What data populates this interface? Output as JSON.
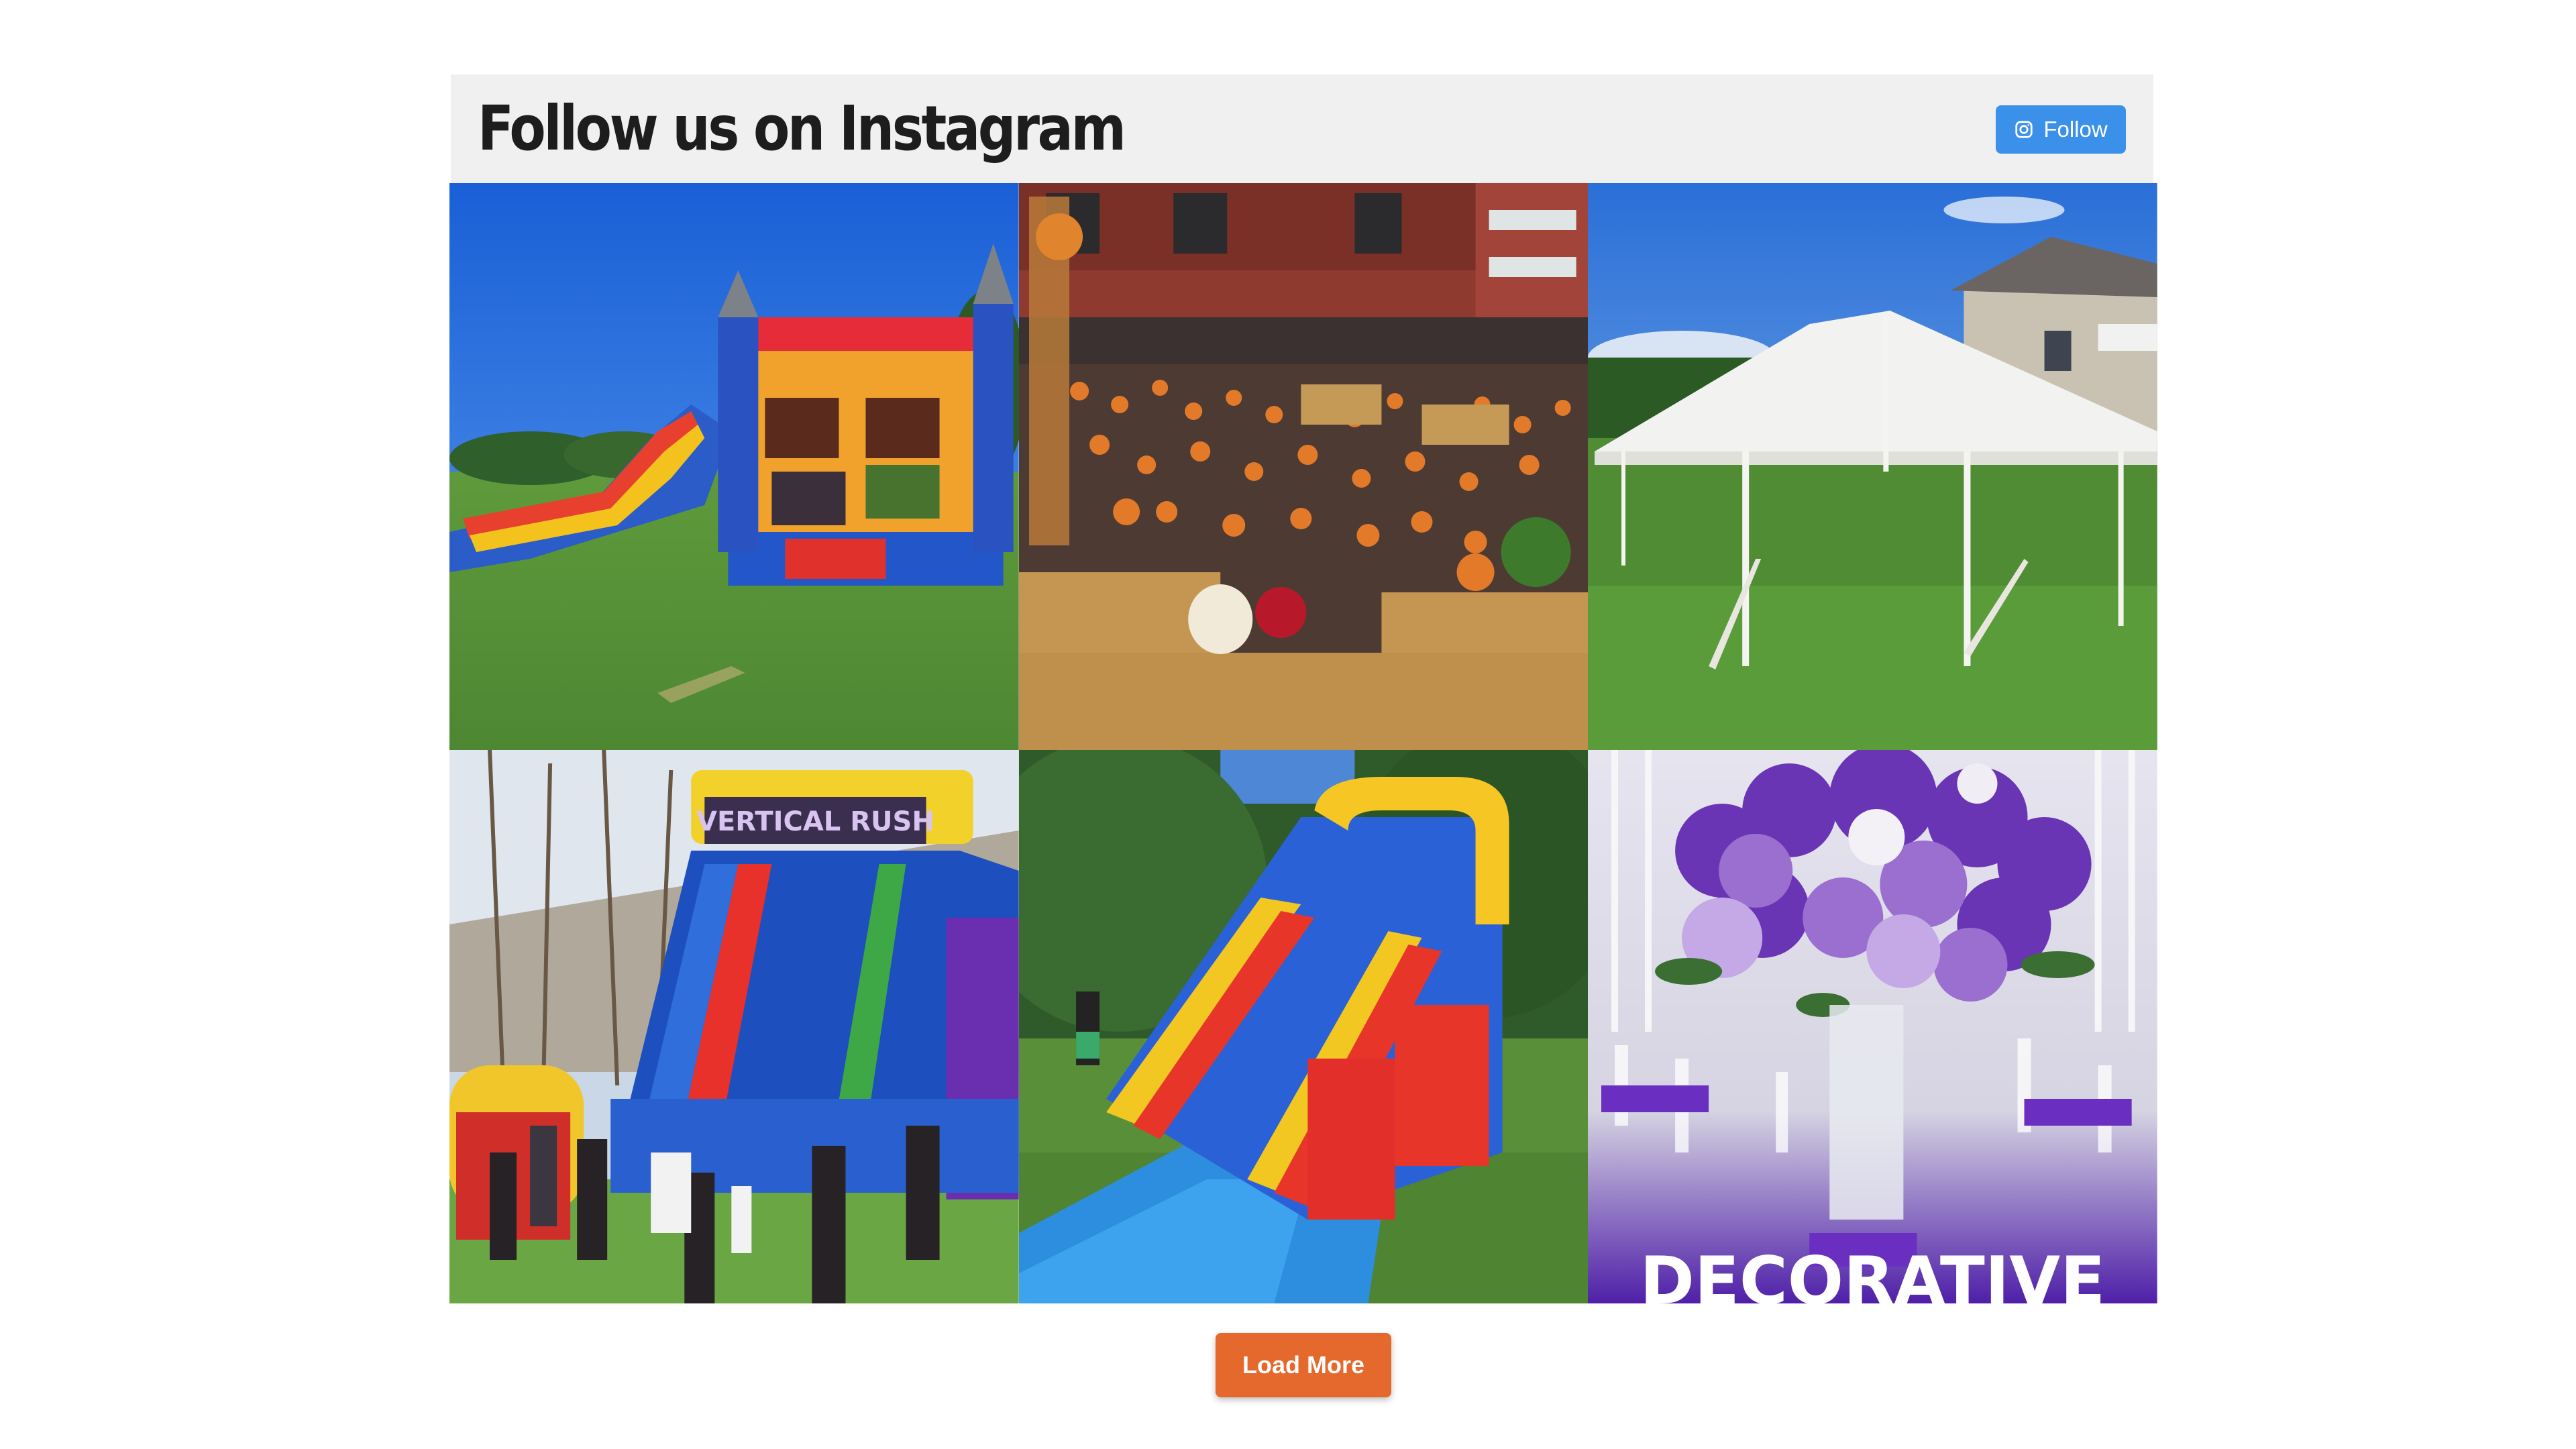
{
  "feed": {
    "title": "Follow us on Instagram",
    "follow_label": "Follow",
    "follow_icon": "instagram-icon",
    "follow_color": "#3b91e9"
  },
  "posts": [
    {
      "name": "bounce-house-combo"
    },
    {
      "name": "pumpkin-patch"
    },
    {
      "name": "white-tent"
    },
    {
      "name": "vertical-rush-slide",
      "sign_text": "VERTICAL RUSH"
    },
    {
      "name": "water-slide"
    },
    {
      "name": "purple-centerpiece",
      "caption_text": "DECORATIVE"
    }
  ],
  "load_more": {
    "label": "Load More",
    "color": "#e5692c"
  }
}
